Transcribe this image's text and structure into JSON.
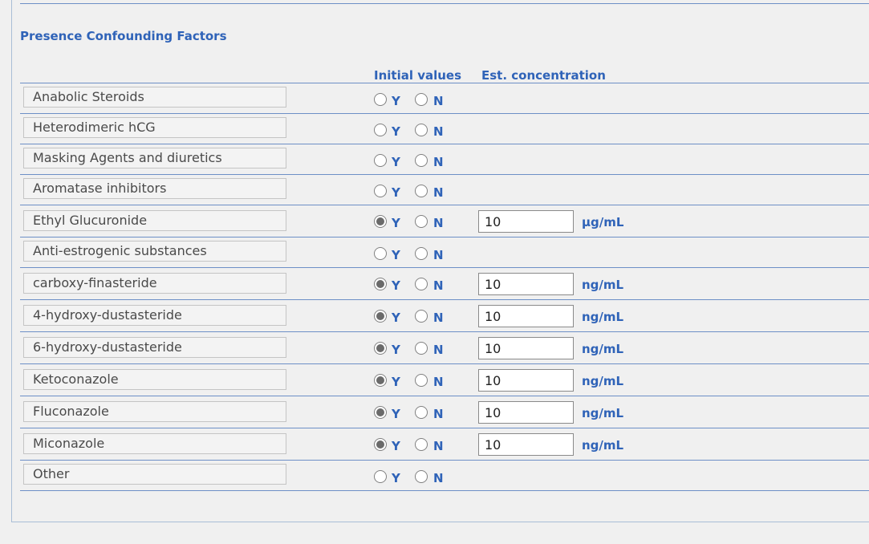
{
  "section": {
    "title": "Presence Confounding Factors",
    "columns": {
      "initial": "Initial values",
      "concentration": "Est. concentration"
    }
  },
  "radio_labels": {
    "yes": "Y",
    "no": "N"
  },
  "rows": [
    {
      "label": "Anabolic Steroids",
      "selected": "none",
      "concentration": null,
      "unit": null
    },
    {
      "label": "Heterodimeric hCG",
      "selected": "none",
      "concentration": null,
      "unit": null
    },
    {
      "label": "Masking Agents and diuretics",
      "selected": "none",
      "concentration": null,
      "unit": null
    },
    {
      "label": "Aromatase inhibitors",
      "selected": "none",
      "concentration": null,
      "unit": null
    },
    {
      "label": "Ethyl Glucuronide",
      "selected": "Y",
      "concentration": "10",
      "unit": "µg/mL"
    },
    {
      "label": "Anti-estrogenic substances",
      "selected": "none",
      "concentration": null,
      "unit": null
    },
    {
      "label": "carboxy-finasteride",
      "selected": "Y",
      "concentration": "10",
      "unit": "ng/mL"
    },
    {
      "label": "4-hydroxy-dustasteride",
      "selected": "Y",
      "concentration": "10",
      "unit": "ng/mL"
    },
    {
      "label": "6-hydroxy-dustasteride",
      "selected": "Y",
      "concentration": "10",
      "unit": "ng/mL"
    },
    {
      "label": "Ketoconazole",
      "selected": "Y",
      "concentration": "10",
      "unit": "ng/mL"
    },
    {
      "label": "Fluconazole",
      "selected": "Y",
      "concentration": "10",
      "unit": "ng/mL"
    },
    {
      "label": "Miconazole",
      "selected": "Y",
      "concentration": "10",
      "unit": "ng/mL"
    },
    {
      "label": "Other",
      "selected": "none",
      "concentration": null,
      "unit": null
    }
  ]
}
